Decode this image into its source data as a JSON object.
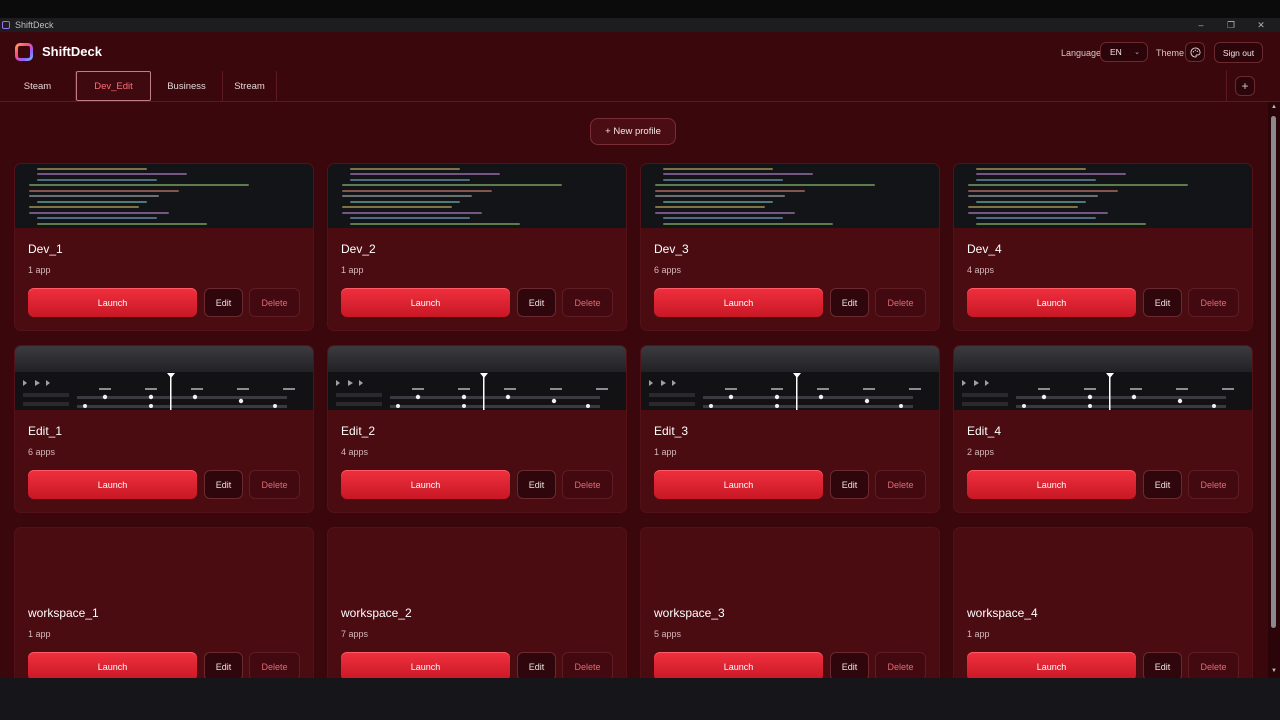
{
  "window": {
    "title": "ShiftDeck",
    "minimize_icon": "minimize-icon",
    "maximize_icon": "restore-icon",
    "close_icon": "close-icon"
  },
  "header": {
    "brand": "ShiftDeck",
    "language_label": "Language",
    "language_value": "EN",
    "theme_label": "Theme",
    "signout_label": "Sign out"
  },
  "tabs": [
    {
      "label": "Steam",
      "active": false
    },
    {
      "label": "Dev_Edit",
      "active": true
    },
    {
      "label": "Business",
      "active": false
    },
    {
      "label": "Stream",
      "active": false
    }
  ],
  "new_profile_label": "+ New profile",
  "buttons": {
    "launch": "Launch",
    "edit": "Edit",
    "delete": "Delete"
  },
  "cards": [
    {
      "title": "Dev_1",
      "apps": "1 app",
      "thumb": "code"
    },
    {
      "title": "Dev_2",
      "apps": "1 app",
      "thumb": "code"
    },
    {
      "title": "Dev_3",
      "apps": "6 apps",
      "thumb": "code"
    },
    {
      "title": "Dev_4",
      "apps": "4 apps",
      "thumb": "code"
    },
    {
      "title": "Edit_1",
      "apps": "6 apps",
      "thumb": "timeline"
    },
    {
      "title": "Edit_2",
      "apps": "4 apps",
      "thumb": "timeline"
    },
    {
      "title": "Edit_3",
      "apps": "1 app",
      "thumb": "timeline"
    },
    {
      "title": "Edit_4",
      "apps": "2 apps",
      "thumb": "timeline"
    },
    {
      "title": "workspace_1",
      "apps": "1 app",
      "thumb": "empty"
    },
    {
      "title": "workspace_2",
      "apps": "7 apps",
      "thumb": "empty"
    },
    {
      "title": "workspace_3",
      "apps": "5 apps",
      "thumb": "empty"
    },
    {
      "title": "workspace_4",
      "apps": "1 app",
      "thumb": "empty"
    }
  ],
  "colors": {
    "accent": "#e52433",
    "background": "#3a070c",
    "card": "#4a0b11"
  }
}
